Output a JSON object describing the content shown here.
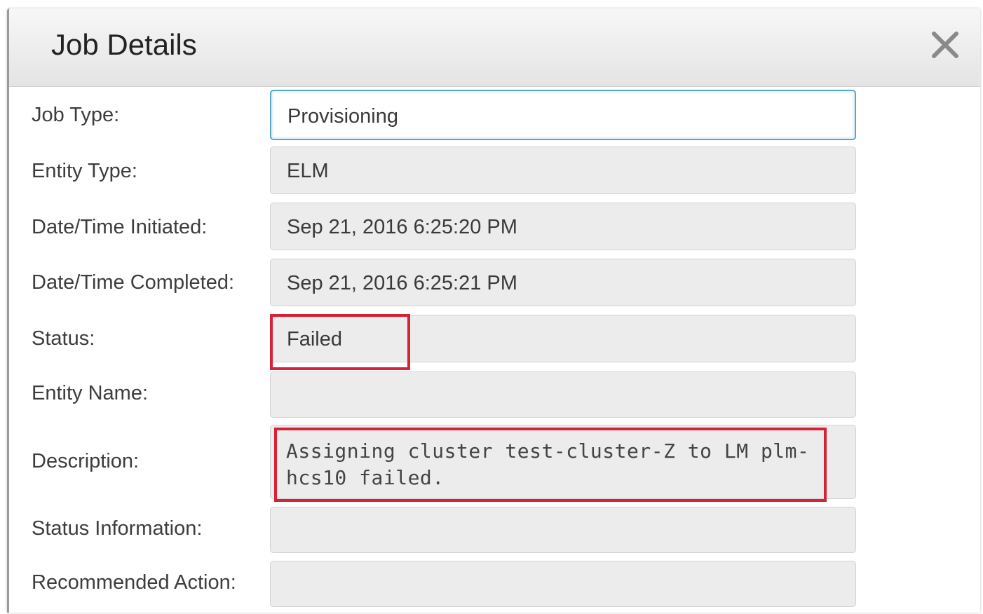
{
  "dialog": {
    "title": "Job Details",
    "close_icon": "close-icon"
  },
  "fields": {
    "job_type": {
      "label": "Job Type:",
      "value": "Provisioning"
    },
    "entity_type": {
      "label": "Entity Type:",
      "value": "ELM"
    },
    "initiated": {
      "label": "Date/Time Initiated:",
      "value": "Sep 21, 2016 6:25:20 PM"
    },
    "completed": {
      "label": "Date/Time Completed:",
      "value": "Sep 21, 2016 6:25:21 PM"
    },
    "status": {
      "label": "Status:",
      "value": "Failed"
    },
    "entity_name": {
      "label": "Entity Name:",
      "value": ""
    },
    "description": {
      "label": "Description:",
      "value": "Assigning cluster test-cluster-Z to LM plm-hcs10 failed."
    },
    "status_information": {
      "label": "Status Information:",
      "value": ""
    },
    "recommended_action": {
      "label": "Recommended Action:",
      "value": ""
    }
  },
  "colors": {
    "highlight": "#d62236",
    "active_border": "#5aa6c9"
  }
}
